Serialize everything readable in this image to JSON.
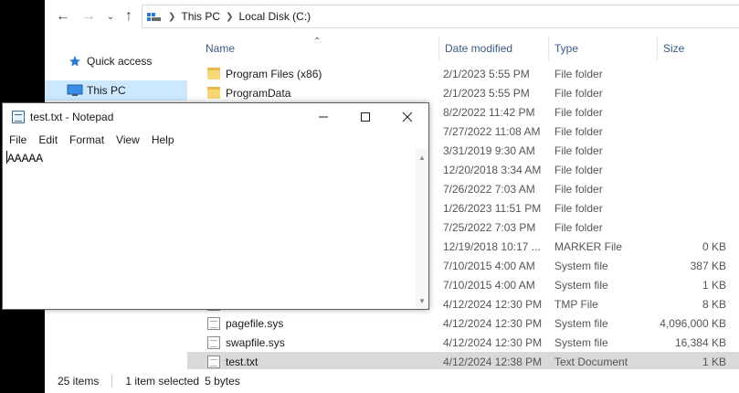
{
  "explorer": {
    "breadcrumb": [
      "This PC",
      "Local Disk (C:)"
    ],
    "nav": [
      {
        "label": "Quick access",
        "icon": "star-icon"
      },
      {
        "label": "This PC",
        "icon": "computer-icon",
        "selected": true
      }
    ],
    "columns": [
      "Name",
      "Date modified",
      "Type",
      "Size"
    ],
    "rows": [
      {
        "name": "Program Files (x86)",
        "date": "2/1/2023 5:55 PM",
        "type": "File folder",
        "size": "",
        "icon": "folder"
      },
      {
        "name": "ProgramData",
        "date": "2/1/2023 5:55 PM",
        "type": "File folder",
        "size": "",
        "icon": "folder"
      },
      {
        "name": "",
        "date": "8/2/2022 11:42 PM",
        "type": "File folder",
        "size": "",
        "icon": "folder"
      },
      {
        "name": "",
        "date": "7/27/2022 11:08 AM",
        "type": "File folder",
        "size": "",
        "icon": "folder"
      },
      {
        "name": "",
        "date": "3/31/2019 9:30 AM",
        "type": "File folder",
        "size": "",
        "icon": "folder"
      },
      {
        "name": "",
        "date": "12/20/2018 3:34 AM",
        "type": "File folder",
        "size": "",
        "icon": "folder"
      },
      {
        "name": "",
        "date": "7/26/2022 7:03 AM",
        "type": "File folder",
        "size": "",
        "icon": "folder"
      },
      {
        "name": "",
        "date": "1/26/2023 11:51 PM",
        "type": "File folder",
        "size": "",
        "icon": "folder"
      },
      {
        "name": "",
        "date": "7/25/2022 7:03 PM",
        "type": "File folder",
        "size": "",
        "icon": "folder"
      },
      {
        "name": "",
        "date": "12/19/2018 10:17 ...",
        "type": "MARKER File",
        "size": "0 KB",
        "icon": "doc"
      },
      {
        "name": "",
        "date": "7/10/2015 4:00 AM",
        "type": "System file",
        "size": "387 KB",
        "icon": "doc"
      },
      {
        "name": "",
        "date": "7/10/2015 4:00 AM",
        "type": "System file",
        "size": "1 KB",
        "icon": "doc"
      },
      {
        "name": "",
        "date": "4/12/2024 12:30 PM",
        "type": "TMP File",
        "size": "8 KB",
        "icon": "doc"
      },
      {
        "name": "pagefile.sys",
        "date": "4/12/2024 12:30 PM",
        "type": "System file",
        "size": "4,096,000 KB",
        "icon": "doc"
      },
      {
        "name": "swapfile.sys",
        "date": "4/12/2024 12:30 PM",
        "type": "System file",
        "size": "16,384 KB",
        "icon": "doc"
      },
      {
        "name": "test.txt",
        "date": "4/12/2024 12:38 PM",
        "type": "Text Document",
        "size": "1 KB",
        "icon": "doc",
        "selected": true
      }
    ],
    "status": {
      "items": "25 items",
      "selected": "1 item selected",
      "bytes": "5 bytes"
    }
  },
  "notepad": {
    "title": "test.txt - Notepad",
    "menu": [
      "File",
      "Edit",
      "Format",
      "View",
      "Help"
    ],
    "content": "AAAAA"
  }
}
